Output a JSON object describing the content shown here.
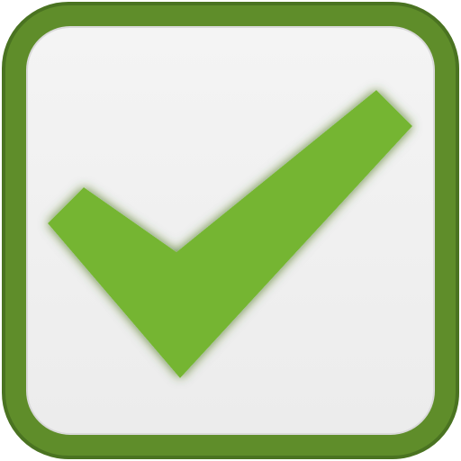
{
  "icon": {
    "semantic": "checkmark-icon",
    "state": "checked",
    "colors": {
      "frame_outer": "#5f8d2a",
      "frame_border": "#4a7321",
      "panel": "#f0f0f0",
      "panel_edge": "#d9d9d9",
      "check_fill": "#74b531",
      "check_shadow": "#3d6a12"
    }
  }
}
